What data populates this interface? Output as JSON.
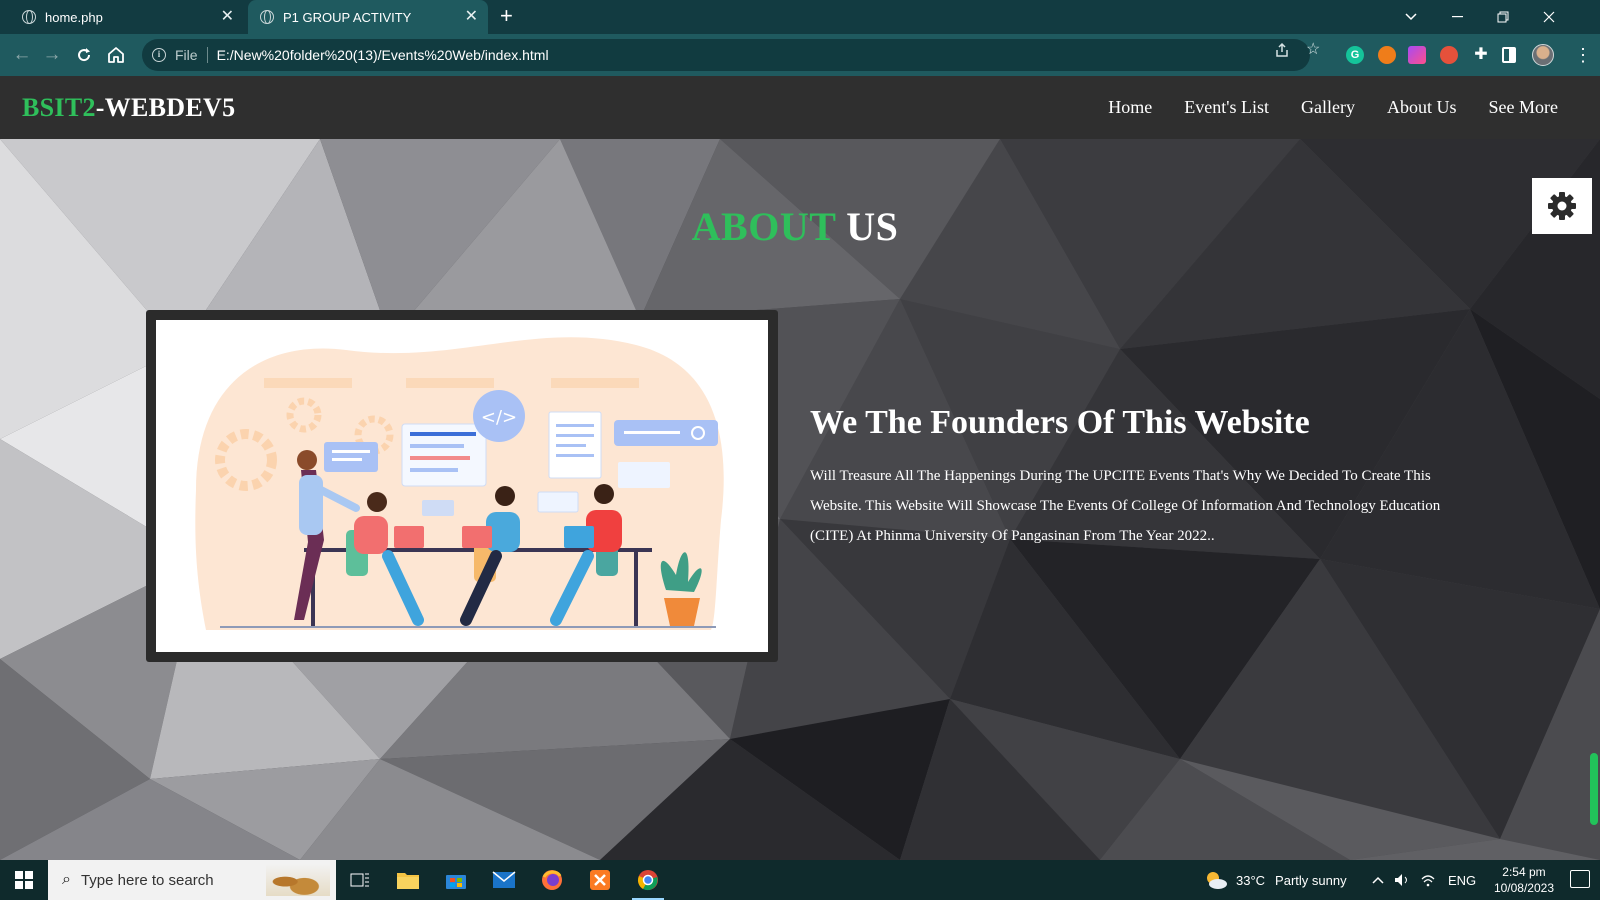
{
  "browser": {
    "tabs": [
      {
        "title": "home.php",
        "active": false
      },
      {
        "title": "P1 GROUP ACTIVITY",
        "active": true
      }
    ],
    "address": {
      "scheme_label": "File",
      "url": "E:/New%20folder%20(13)/Events%20Web/index.html"
    },
    "extensions": [
      "grammarly-icon",
      "ext-orange-icon",
      "ext-purple-icon",
      "ext-badge-icon",
      "puzzle-icon",
      "side-panel-icon",
      "profile-avatar"
    ],
    "colors": {
      "tabbar": "#123b41",
      "toolbar": "#1f5a5f"
    }
  },
  "site": {
    "brand": {
      "accent": "BSIT2",
      "rest": "-WEBDEV5"
    },
    "nav": [
      {
        "label": "Home"
      },
      {
        "label": "Event's List"
      },
      {
        "label": "Gallery"
      },
      {
        "label": "About Us"
      },
      {
        "label": "See More"
      }
    ],
    "about": {
      "title_accent": "ABOUT",
      "title_rest": " US",
      "heading": "We The Founders Of This Website",
      "text": "Will Treasure All The Happenings During The UPCITE Events That's Why We Decided To Create This Website. This Website Will Showcase The Events Of College Of Information And Technology Education (CITE) At Phinma University Of Pangasinan From The Year 2022.."
    },
    "colors": {
      "accent": "#2fbf5b",
      "navbar": "#2f2f2f"
    }
  },
  "taskbar": {
    "search_placeholder": "Type here to search",
    "apps": [
      "task-view-icon",
      "file-explorer-icon",
      "microsoft-store-icon",
      "mail-icon",
      "firefox-icon",
      "xampp-icon",
      "chrome-icon"
    ],
    "weather": {
      "temp": "33°C",
      "condition": "Partly sunny"
    },
    "language": "ENG",
    "time": "2:54 pm",
    "date": "10/08/2023"
  }
}
